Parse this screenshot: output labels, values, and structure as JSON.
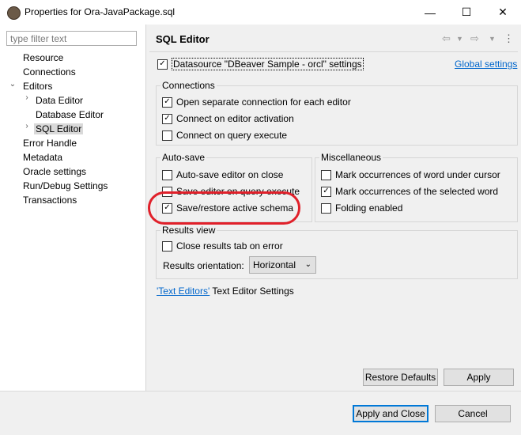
{
  "window": {
    "title": "Properties for Ora-JavaPackage.sql",
    "minimize_icon": "minimize-icon",
    "maximize_icon": "maximize-icon",
    "close_icon": "close-icon"
  },
  "sidebar": {
    "filter_placeholder": "type filter text",
    "items": [
      {
        "label": "Resource"
      },
      {
        "label": "Connections"
      },
      {
        "label": "Editors"
      },
      {
        "label": "Data Editor"
      },
      {
        "label": "Database Editor"
      },
      {
        "label": "SQL Editor"
      },
      {
        "label": "Error Handle"
      },
      {
        "label": "Metadata"
      },
      {
        "label": "Oracle settings"
      },
      {
        "label": "Run/Debug Settings"
      },
      {
        "label": "Transactions"
      }
    ]
  },
  "page": {
    "title": "SQL Editor",
    "datasource_label": "Datasource \"DBeaver Sample - orcl\" settings",
    "datasource_checked": true,
    "global_settings_link": "Global settings",
    "connections": {
      "title": "Connections",
      "items": [
        {
          "label": "Open separate connection for each editor",
          "checked": true
        },
        {
          "label": "Connect on editor activation",
          "checked": true
        },
        {
          "label": "Connect on query execute",
          "checked": false
        }
      ]
    },
    "autosave": {
      "title": "Auto-save",
      "items": [
        {
          "label": "Auto-save editor on close",
          "checked": false
        },
        {
          "label": "Save editor on query execute",
          "checked": false
        },
        {
          "label": "Save/restore active schema",
          "checked": true
        }
      ]
    },
    "misc": {
      "title": "Miscellaneous",
      "items": [
        {
          "label": "Mark occurrences of word under cursor",
          "checked": false
        },
        {
          "label": "Mark occurrences of the selected word",
          "checked": true
        },
        {
          "label": "Folding enabled",
          "checked": false
        }
      ]
    },
    "results": {
      "title": "Results view",
      "close_tab_label": "Close results tab on error",
      "close_tab_checked": false,
      "orientation_label": "Results orientation:",
      "orientation_value": "Horizontal"
    },
    "text_editors_link": "'Text Editors'",
    "text_editors_suffix": " Text Editor Settings",
    "restore_defaults": "Restore Defaults",
    "apply": "Apply"
  },
  "footer": {
    "apply_close": "Apply and Close",
    "cancel": "Cancel"
  },
  "colors": {
    "highlight_oval": "#e0202a",
    "link": "#0066cc"
  }
}
